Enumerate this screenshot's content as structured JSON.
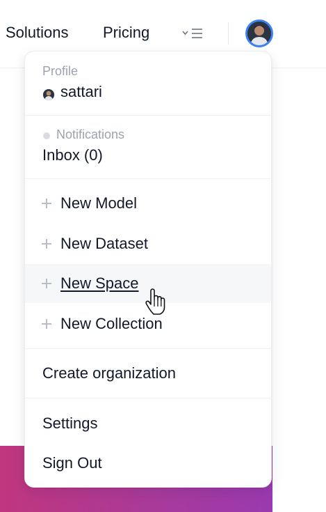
{
  "nav": {
    "solutions": "Solutions",
    "pricing": "Pricing",
    "menu_icon": "menu-chevron-icon",
    "avatar_icon": "user-avatar"
  },
  "dropdown": {
    "profile_label": "Profile",
    "username": "sattari",
    "notifications_label": "Notifications",
    "inbox": "Inbox (0)",
    "create_items": [
      {
        "label": "New Model",
        "icon": "plus-icon"
      },
      {
        "label": "New Dataset",
        "icon": "plus-icon"
      },
      {
        "label": "New Space",
        "icon": "plus-icon"
      },
      {
        "label": "New Collection",
        "icon": "plus-icon"
      }
    ],
    "create_organization": "Create organization",
    "settings": "Settings",
    "sign_out": "Sign Out"
  },
  "colors": {
    "avatar_ring": "#3b82f6",
    "banner_start": "#c0367e",
    "banner_end": "#9a3ab0"
  }
}
